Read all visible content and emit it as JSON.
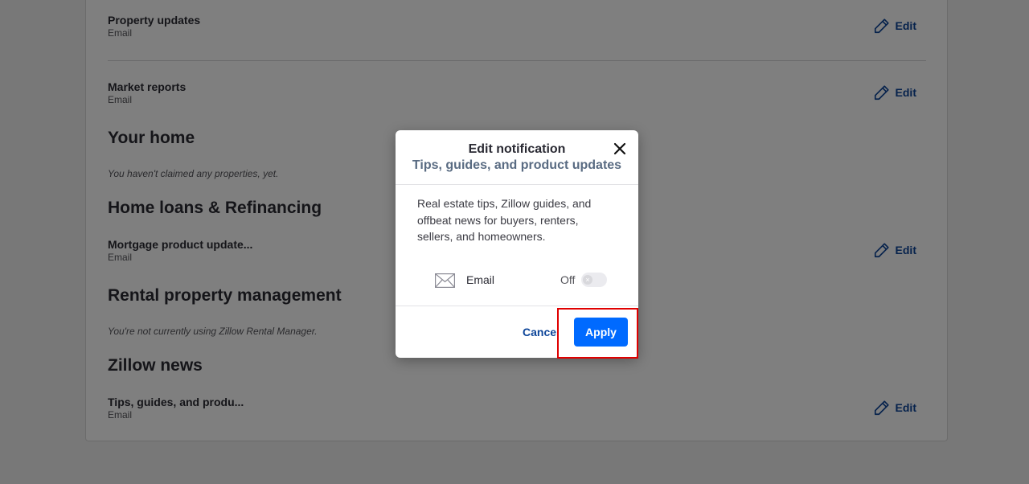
{
  "page": {
    "rows": [
      {
        "title": "Property updates",
        "sub": "Email",
        "edit": "Edit"
      },
      {
        "title": "Market reports",
        "sub": "Email",
        "edit": "Edit"
      },
      {
        "title": "Mortgage product update...",
        "sub": "Email",
        "edit": "Edit"
      },
      {
        "title": "Tips, guides, and produ...",
        "sub": "Email",
        "edit": "Edit"
      }
    ],
    "sections": {
      "your_home": "Your home",
      "your_home_note": "You haven't claimed any properties, yet.",
      "home_loans": "Home loans & Refinancing",
      "rental": "Rental property management",
      "rental_note": "You're not currently using Zillow Rental Manager.",
      "zillow_news": "Zillow news"
    }
  },
  "modal": {
    "title": "Edit notification",
    "subtitle": "Tips, guides, and product updates",
    "description": "Real estate tips, Zillow guides, and offbeat news for buyers, renters, sellers, and homeowners.",
    "channel": {
      "icon": "mail-icon",
      "label": "Email",
      "state": "Off",
      "enabled": false
    },
    "cancel_label": "Cancel",
    "apply_label": "Apply"
  },
  "colors": {
    "link": "#0d4599",
    "primary": "#006aff",
    "highlight": "#e00000"
  }
}
